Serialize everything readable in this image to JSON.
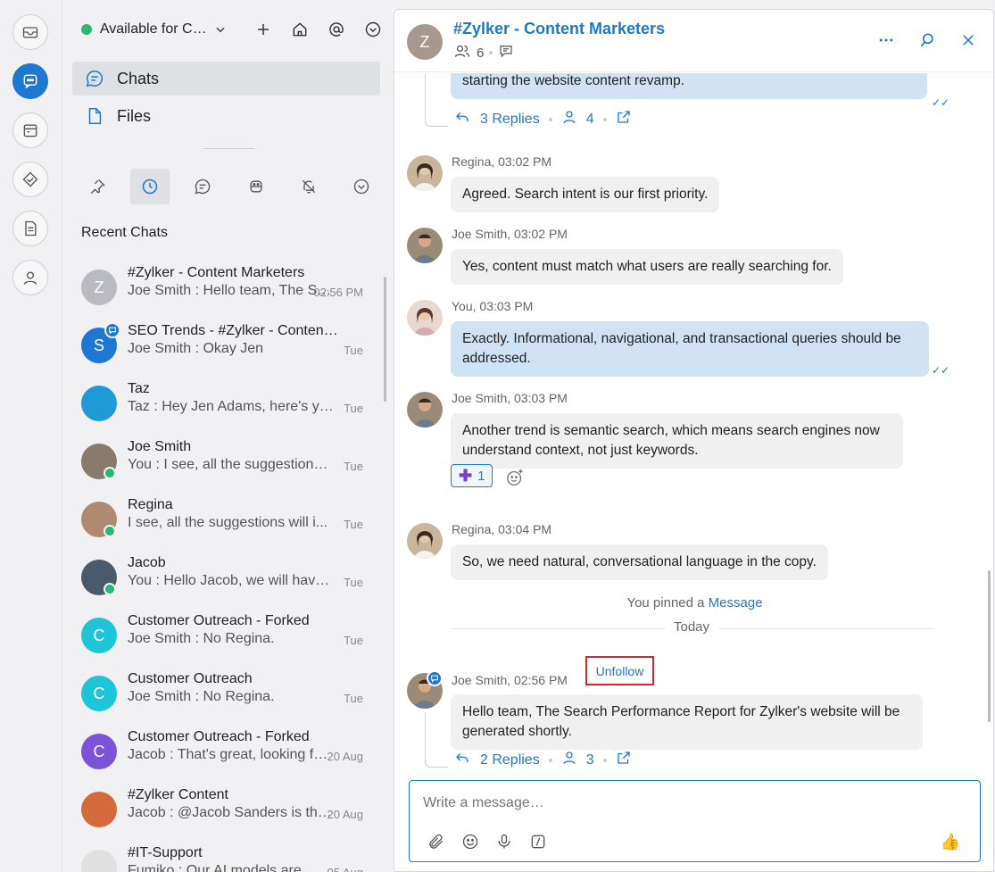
{
  "status": {
    "label": "Available for Chat"
  },
  "nav": {
    "chats": "Chats",
    "files": "Files"
  },
  "recent_title": "Recent Chats",
  "chats": [
    {
      "name": "#Zylker - Content Marketers",
      "preview": "Joe Smith : Hello team, The Search Performance Report",
      "time": "02:56 PM",
      "initial": "Z",
      "color": "#b9bbc0"
    },
    {
      "name": "SEO Trends - #Zylker - Content Marketers",
      "preview": "Joe Smith : Okay Jen",
      "time": "Tue",
      "initial": "S",
      "color": "#1e78d2"
    },
    {
      "name": "Taz",
      "preview": "Taz : Hey Jen Adams, here's your daily summary",
      "time": "Tue",
      "initial": "",
      "color": "#1e9bd7"
    },
    {
      "name": "Joe Smith",
      "preview": "You : I see, all the suggestions will be added",
      "time": "Tue",
      "initial": "",
      "color": "#8a7a6a"
    },
    {
      "name": "Regina",
      "preview": "I see, all the suggestions will i...",
      "time": "Tue",
      "initial": "",
      "color": "#b08a70"
    },
    {
      "name": "Jacob",
      "preview": "You : Hello Jacob, we will have a meeting",
      "time": "Tue",
      "initial": "",
      "color": "#4a5a6a"
    },
    {
      "name": "Customer Outreach - Forked",
      "preview": "Joe Smith : No Regina.",
      "time": "Tue",
      "initial": "C",
      "color": "#1ec5d8"
    },
    {
      "name": "Customer Outreach",
      "preview": "Joe Smith : No Regina.",
      "time": "Tue",
      "initial": "C",
      "color": "#1ec5d8"
    },
    {
      "name": "Customer Outreach - Forked",
      "preview": "Jacob : That's great, looking forward to it",
      "time": "20 Aug",
      "initial": "C",
      "color": "#7b52d8"
    },
    {
      "name": "#Zylker Content",
      "preview": "Jacob : @Jacob Sanders  is this done",
      "time": "20 Aug",
      "initial": "",
      "color": "#d46a3a"
    },
    {
      "name": "#IT-Support",
      "preview": "Fumiko : Our AI models are",
      "time": "05 Aug",
      "initial": "",
      "color": "#e0e0e0"
    }
  ],
  "header": {
    "title": "#Zylker - Content Marketers",
    "initial": "Z",
    "member_count": "6"
  },
  "messages": {
    "m0": {
      "text": "starting the website content revamp.",
      "replies": "3 Replies",
      "participants": "4"
    },
    "m1": {
      "sender": "Regina, 03:02 PM",
      "text": "Agreed. Search intent is our first priority."
    },
    "m2": {
      "sender": "Joe Smith, 03:02 PM",
      "text": "Yes, content must match what users are really searching for."
    },
    "m3": {
      "sender": "You, 03:03 PM",
      "text": "Exactly. Informational, navigational, and transactional queries should be addressed."
    },
    "m4": {
      "sender": "Joe Smith, 03:03 PM",
      "text": "Another trend is semantic search, which means search engines now understand context, not just keywords.",
      "reaction_count": "1"
    },
    "m5": {
      "sender": "Regina, 03:04 PM",
      "text": "So, we need natural, conversational language in the copy."
    },
    "pinned_prefix": "You pinned a",
    "pinned_link": "Message",
    "today": "Today",
    "m6": {
      "sender": "Joe Smith, 02:56 PM",
      "unfollow": "Unfollow",
      "text": "Hello team, The Search Performance Report for Zylker's website will be generated shortly.",
      "replies": "2 Replies",
      "participants": "3"
    }
  },
  "composer": {
    "placeholder": "Write a message…"
  }
}
